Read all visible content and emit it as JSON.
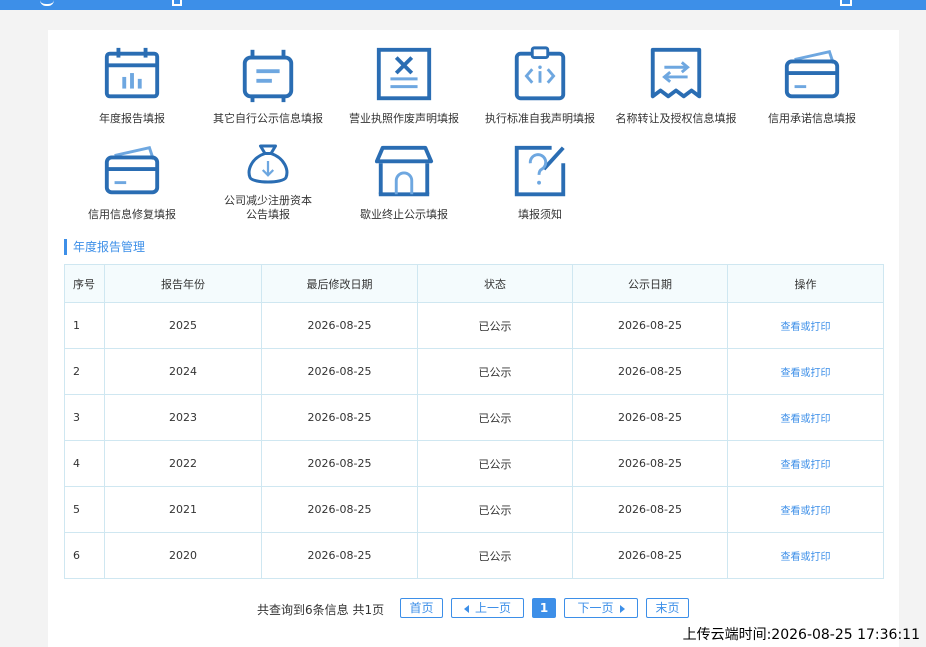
{
  "colors": {
    "accent": "#3d8fe8",
    "icon": "#2a6db3",
    "header": "#3d8fe8"
  },
  "tiles": [
    {
      "label": "年度报告填报",
      "icon": "calendar-chart-icon"
    },
    {
      "label": "其它自行公示信息填报",
      "icon": "scroll-document-icon"
    },
    {
      "label": "营业执照作废声明填报",
      "icon": "void-license-icon"
    },
    {
      "label": "执行标准自我声明填报",
      "icon": "code-clipboard-icon"
    },
    {
      "label": "名称转让及授权信息填报",
      "icon": "transfer-certificate-icon"
    },
    {
      "label": "信用承诺信息填报",
      "icon": "credit-card-icon"
    },
    {
      "label": "信用信息修复填报",
      "icon": "credit-card-icon"
    },
    {
      "label1": "公司减少注册资本",
      "label2": "公告填报",
      "icon": "money-bag-down-icon"
    },
    {
      "label": "歇业终止公示填报",
      "icon": "storefront-icon"
    },
    {
      "label": "填报须知",
      "icon": "question-edit-icon"
    }
  ],
  "section": {
    "title": "年度报告管理"
  },
  "table": {
    "headers": [
      "序号",
      "报告年份",
      "最后修改日期",
      "状态",
      "公示日期",
      "操作"
    ],
    "rows": [
      {
        "idx": "1",
        "year": "2025",
        "modified": "2026-08-25",
        "status": "已公示",
        "pub": "2026-08-25",
        "op": "查看或打印"
      },
      {
        "idx": "2",
        "year": "2024",
        "modified": "2026-08-25",
        "status": "已公示",
        "pub": "2026-08-25",
        "op": "查看或打印"
      },
      {
        "idx": "3",
        "year": "2023",
        "modified": "2026-08-25",
        "status": "已公示",
        "pub": "2026-08-25",
        "op": "查看或打印"
      },
      {
        "idx": "4",
        "year": "2022",
        "modified": "2026-08-25",
        "status": "已公示",
        "pub": "2026-08-25",
        "op": "查看或打印"
      },
      {
        "idx": "5",
        "year": "2021",
        "modified": "2026-08-25",
        "status": "已公示",
        "pub": "2026-08-25",
        "op": "查看或打印"
      },
      {
        "idx": "6",
        "year": "2020",
        "modified": "2026-08-25",
        "status": "已公示",
        "pub": "2026-08-25",
        "op": "查看或打印"
      }
    ]
  },
  "pager": {
    "info": "共查询到6条信息 共1页",
    "first": "首页",
    "prev": "上一页",
    "current": "1",
    "next": "下一页",
    "last": "末页"
  },
  "timestamp": "上传云端时间:2026-08-25 17:36:11"
}
